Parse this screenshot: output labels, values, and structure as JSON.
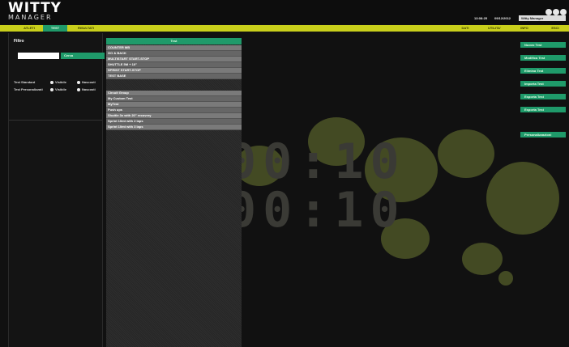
{
  "header": {
    "logo_line1": "WITTY",
    "logo_line2": "MANAGER",
    "time": "13:08:25",
    "date": "09/12/2012",
    "user": "Witty Manager"
  },
  "nav": {
    "items": [
      {
        "label": "ATLETI",
        "active": false
      },
      {
        "label": "TEST",
        "active": true
      },
      {
        "label": "RISULTATI",
        "active": false
      },
      {
        "label": "DATI",
        "active": false
      },
      {
        "label": "UTILITA'",
        "active": false
      },
      {
        "label": "INFO",
        "active": false
      },
      {
        "label": "ESCI",
        "active": false
      }
    ]
  },
  "sidebar": {
    "title": "Filtro",
    "search_value": "",
    "search_button": "Cerca",
    "filters": [
      {
        "label": "Test Standard",
        "options": [
          "Visibile",
          "Nascosti"
        ]
      },
      {
        "label": "Test Personalizzati",
        "options": [
          "Visibile",
          "Nascosti"
        ]
      }
    ]
  },
  "tests": {
    "header": "Test",
    "standard": [
      "COUNTER MB",
      "GO & BACK",
      "MULTISTART START-STOP",
      "SHUTTLE 5M + 10\"",
      "SPRINT START-STOP",
      "TEST BASE"
    ],
    "custom": [
      "Circuit Group",
      "My Custom Test",
      "MyTest",
      "Push ups",
      "Shuttle 3x with 20\" recovery",
      "Sprint 10mt with 2 laps",
      "Sprint 10mt with 3 laps"
    ]
  },
  "actions": {
    "buttons": [
      "Nuovo Test",
      "Modifica Test",
      "Elimina Test",
      "Importa Test",
      "Esporta Test",
      "Esporta Test"
    ],
    "extra_button": "Personalizzazioni"
  },
  "background": {
    "digits_line1": "00:10",
    "digits_line2": "00:10"
  },
  "colors": {
    "accent": "#1f9a6a",
    "nav_bar": "#c9cf1b",
    "background": "#111111"
  }
}
